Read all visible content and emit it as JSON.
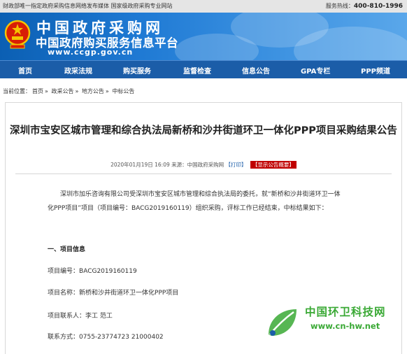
{
  "topbar": {
    "notice": "财政部唯一指定政府采购信息网络发布媒体 国家级政府采购专业网站",
    "service_label": "服务热线：",
    "hotline": "400-810-1996"
  },
  "banner": {
    "title": "中国政府采购网",
    "subtitle": "中国政府购买服务信息平台",
    "url": "www.ccgp.gov.cn",
    "colors": {
      "nav": "#1b5da8",
      "banner": "#1f7ad4"
    }
  },
  "nav": {
    "items": [
      "首页",
      "政采法规",
      "购买服务",
      "监督检查",
      "信息公告",
      "GPA专栏",
      "PPP频道"
    ]
  },
  "breadcrumb": {
    "prefix": "当前位置：",
    "items": [
      "首页",
      "政采公告",
      "地方公告",
      "中标公告"
    ],
    "separator": "»"
  },
  "article": {
    "title": "深圳市宝安区城市管理和综合执法局新桥和沙井街道环卫一体化PPP项目采购结果公告",
    "date": "2020年01月19日 16:09",
    "source": "来源：中国政府采购网",
    "print_label": "【打印】",
    "summary_label": "【显示公告概要】",
    "intro_line1": "深圳市加乐咨询有限公司受深圳市宝安区城市管理和综合执法局的委托，就“新桥和沙井街道环卫一体",
    "intro_line2": "化PPP项目”项目（项目编号：BACG2019160119）组织采购，评标工作已经结束，中标结果如下：",
    "section1": "一、项目信息",
    "fields": [
      {
        "label": "项目编号：",
        "value": "BACG2019160119"
      },
      {
        "label": "项目名称：",
        "value": "新桥和沙井街道环卫一体化PPP项目"
      },
      {
        "label": "项目联系人：",
        "value": "李工 范工"
      },
      {
        "label": "联系方式：",
        "value": "0755-23774723 21000402"
      }
    ]
  },
  "watermark": {
    "name": "中国环卫科技网",
    "url": "www.cn-hw.net"
  }
}
